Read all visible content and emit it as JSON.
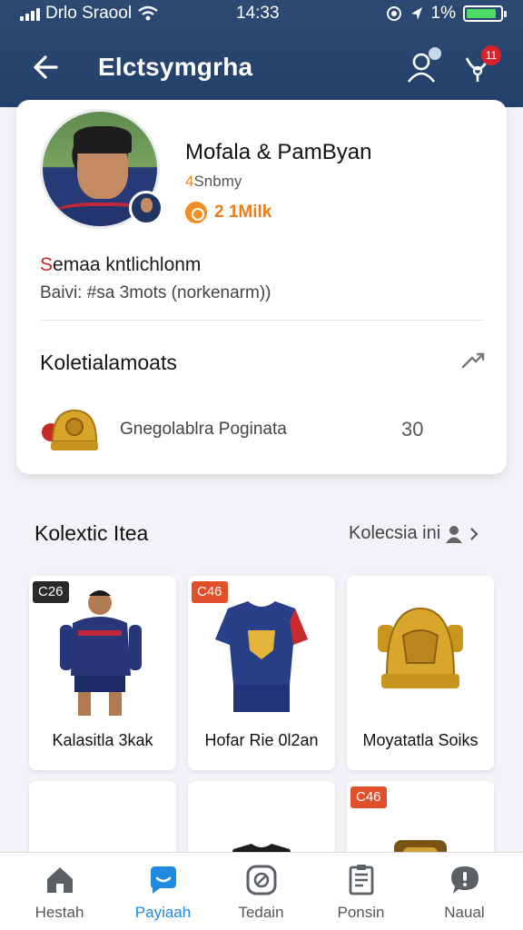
{
  "status_bar": {
    "carrier": "Drlo Sraool",
    "time": "14:33",
    "battery_percent": "1%",
    "battery_level": 0.9
  },
  "header": {
    "title": "Elctsymgrha",
    "notification_count": "11"
  },
  "profile": {
    "name": "Mofala & PamByan",
    "subtitle_number": "4",
    "subtitle_text": "Snbmy",
    "coins": "2 1Milk",
    "bio_title_first": "S",
    "bio_title_rest": "emaa kntlichlonm",
    "bio_subtitle": "Baivi: #sa 3mots (norkenarm))"
  },
  "collection_summary": {
    "title": "Koletialamoats",
    "item_label": "Gnegolablra Poginata",
    "item_count": "30"
  },
  "section": {
    "title": "Kolextic Itea",
    "link": "Kolecsia ini"
  },
  "items": [
    {
      "tag": "C26",
      "label": "Kalasitla 3kak",
      "tag_color": "#2a2a2a"
    },
    {
      "tag": "C46",
      "label": "Hofar Rie 0l2an",
      "tag_color": "#e0502b"
    },
    {
      "tag": "",
      "label": "Moyatatla Soiks",
      "tag_color": "#e0502b"
    },
    {
      "tag": "",
      "label": "",
      "tag_color": "#e0502b"
    },
    {
      "tag": "",
      "label": "",
      "tag_color": "#e0502b"
    },
    {
      "tag": "C46",
      "label": "",
      "tag_color": "#e0502b"
    }
  ],
  "bottom_nav": [
    {
      "label": "Hestah",
      "icon": "home-icon"
    },
    {
      "label": "Payiaah",
      "icon": "chat-icon"
    },
    {
      "label": "Tedain",
      "icon": "ball-icon"
    },
    {
      "label": "Ponsin",
      "icon": "document-icon"
    },
    {
      "label": "Naual",
      "icon": "message-icon"
    }
  ],
  "colors": {
    "header_bg": "#22406a",
    "accent_orange": "#ea7c1a",
    "active_nav": "#1e8ae0",
    "badge_red": "#d8232a"
  }
}
